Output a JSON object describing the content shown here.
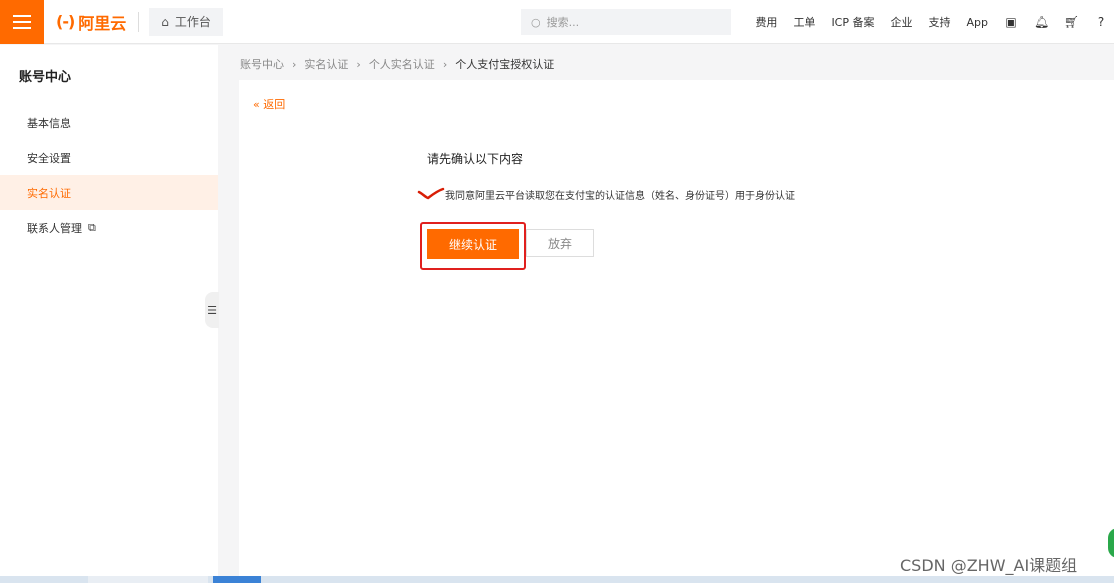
{
  "header": {
    "logo_text": "阿里云",
    "workbench": "工作台",
    "search_placeholder": "搜索...",
    "links": [
      "费用",
      "工单",
      "ICP 备案",
      "企业",
      "支持",
      "App"
    ]
  },
  "sidebar": {
    "title": "账号中心",
    "items": [
      {
        "label": "基本信息"
      },
      {
        "label": "安全设置"
      },
      {
        "label": "实名认证"
      },
      {
        "label": "联系人管理"
      }
    ]
  },
  "breadcrumb": [
    "账号中心",
    "实名认证",
    "个人实名认证",
    "个人支付宝授权认证"
  ],
  "main": {
    "back": "« 返回",
    "confirm_title": "请先确认以下内容",
    "agreement": "我同意阿里云平台读取您在支付宝的认证信息（姓名、身份证号）用于身份认证",
    "continue_button": "继续认证",
    "abandon_button": "放弃"
  },
  "watermark": "CSDN @ZHW_AI课题组",
  "colors": {
    "accent": "#ff6a00",
    "highlight_box": "#e0201e"
  }
}
